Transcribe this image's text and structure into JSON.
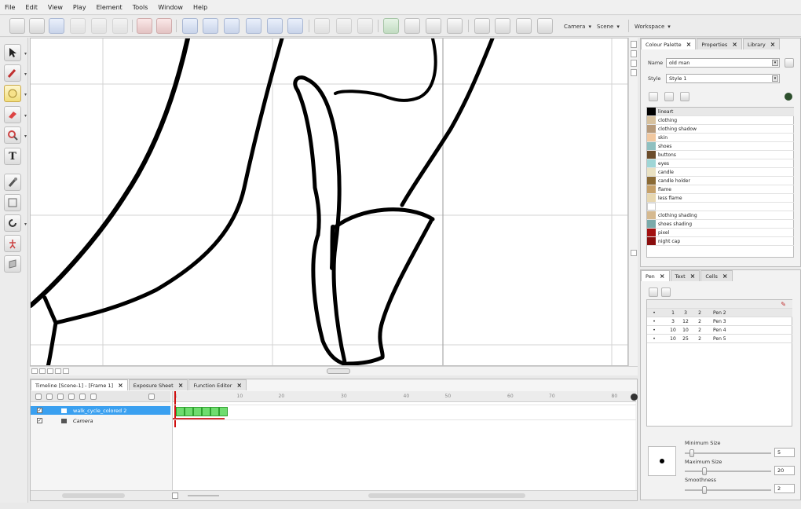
{
  "menu": [
    "File",
    "Edit",
    "View",
    "Play",
    "Element",
    "Tools",
    "Window",
    "Help"
  ],
  "toolbar": {
    "camera_label": "Camera",
    "scene_label": "Scene",
    "workspace_label": "Workspace"
  },
  "timeline": {
    "tabs": [
      "Timeline [Scene-1] - [Frame 1]",
      "Exposure Sheet",
      "Function Editor"
    ],
    "layers": [
      {
        "name": "walk_cycle_colored 2",
        "selected": true
      },
      {
        "name": "Camera",
        "selected": false
      }
    ],
    "ruler": [
      "1",
      "",
      "",
      "10",
      "",
      "20",
      "",
      "",
      "30",
      "",
      "",
      "40",
      "",
      "50",
      "",
      "",
      "60",
      "",
      "70",
      "",
      "",
      "80"
    ]
  },
  "palette": {
    "tabs": [
      "Colour Palette",
      "Properties",
      "Library"
    ],
    "name_label": "Name",
    "name_value": "old man",
    "style_label": "Style",
    "style_value": "Style 1",
    "colors": [
      {
        "name": "lineart",
        "color": "#000000"
      },
      {
        "name": "clothing",
        "color": "#d7c19e"
      },
      {
        "name": "clothing shadow",
        "color": "#b79a7a"
      },
      {
        "name": "skin",
        "color": "#f1c8a0"
      },
      {
        "name": "shoes",
        "color": "#8fc0c0"
      },
      {
        "name": "buttons",
        "color": "#6b4c2b"
      },
      {
        "name": "eyes",
        "color": "#9fd6d6"
      },
      {
        "name": "candle",
        "color": "#e9e1c2"
      },
      {
        "name": "candle holder",
        "color": "#8a6a35"
      },
      {
        "name": "flame",
        "color": "#c6a16a"
      },
      {
        "name": "less flame",
        "color": "#e7d7b0"
      },
      {
        "name": "",
        "color": "#ffffff"
      },
      {
        "name": "clothing shading",
        "color": "#d5b990"
      },
      {
        "name": "shoes shading",
        "color": "#7aaaaa"
      },
      {
        "name": "pixel",
        "color": "#a31010"
      },
      {
        "name": "night cap",
        "color": "#8a0e0e"
      }
    ]
  },
  "pen": {
    "tabs": [
      "Pen",
      "Text",
      "Cells"
    ],
    "rows": [
      {
        "a": "1",
        "b": "3",
        "c": "2",
        "name": "Pen 2"
      },
      {
        "a": "3",
        "b": "12",
        "c": "2",
        "name": "Pen 3"
      },
      {
        "a": "10",
        "b": "10",
        "c": "2",
        "name": "Pen 4"
      },
      {
        "a": "10",
        "b": "25",
        "c": "2",
        "name": "Pen 5"
      }
    ],
    "min_label": "Minimum Size",
    "min_value": "5",
    "max_label": "Maximum Size",
    "max_value": "20",
    "smooth_label": "Smoothness",
    "smooth_value": "2"
  }
}
